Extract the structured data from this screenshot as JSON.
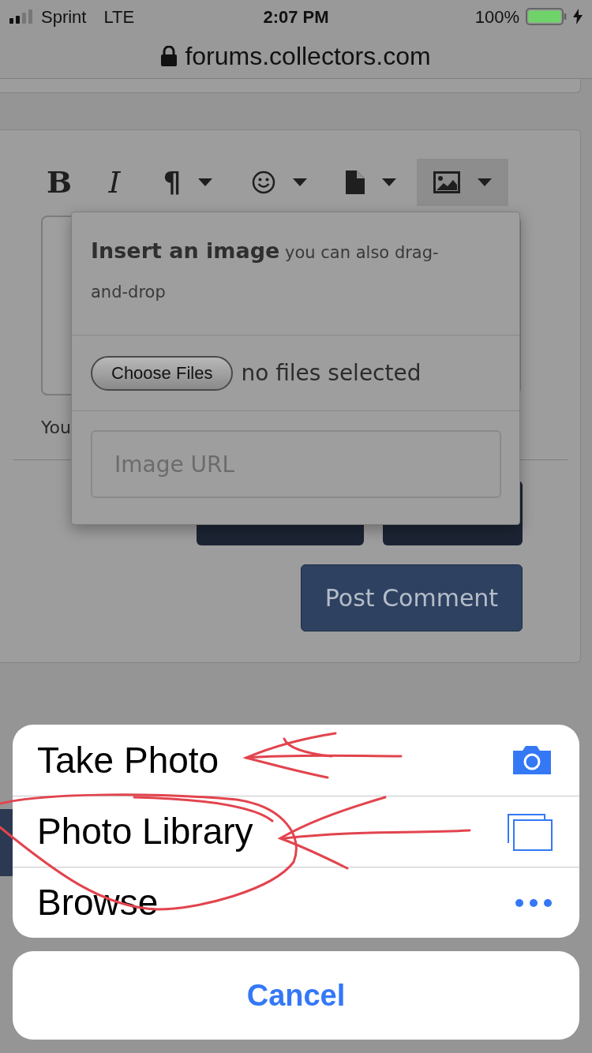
{
  "status_bar": {
    "carrier": "Sprint",
    "network": "LTE",
    "time": "2:07 PM",
    "battery": "100%"
  },
  "address_bar": {
    "url": "forums.collectors.com"
  },
  "toolbar": [
    {
      "kind": "bold",
      "label": "B",
      "dropdown": false,
      "selected": false
    },
    {
      "kind": "italic",
      "label": "I",
      "dropdown": false,
      "selected": false
    },
    {
      "kind": "paragraph",
      "label": "¶",
      "dropdown": true,
      "selected": false
    },
    {
      "kind": "emoji",
      "dropdown": true,
      "selected": false
    },
    {
      "kind": "file",
      "dropdown": true,
      "selected": false
    },
    {
      "kind": "image",
      "dropdown": true,
      "selected": true
    }
  ],
  "editor": {
    "note": "You",
    "post_button": "Post Comment"
  },
  "image_popup": {
    "title": "**Insert an image** you can also drag-and-drop",
    "file_button": "Choose Files",
    "file_status": "no files selected",
    "url_placeholder": "Image URL"
  },
  "action_sheet": {
    "actions": [
      {
        "label": "Take Photo",
        "kind": "camera"
      },
      {
        "label": "Photo Library",
        "kind": "photos"
      },
      {
        "label": "Browse",
        "kind": "more"
      }
    ],
    "cancel": "Cancel"
  }
}
